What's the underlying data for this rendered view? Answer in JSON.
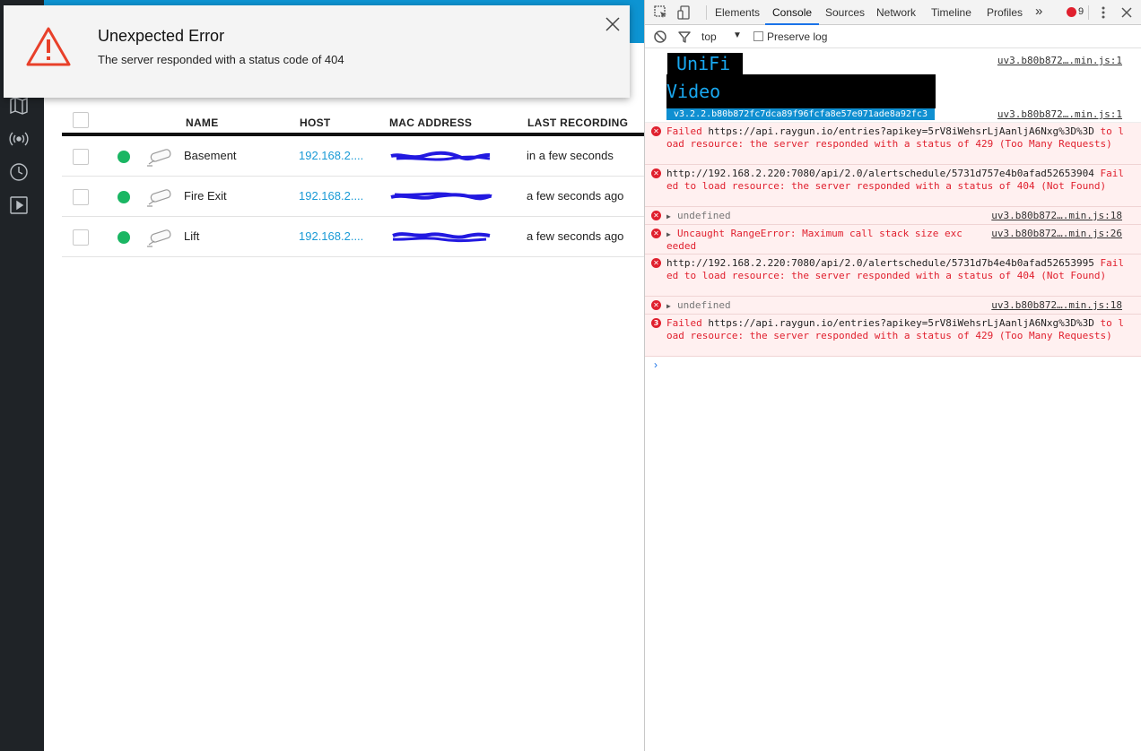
{
  "app": {
    "error": {
      "title": "Unexpected Error",
      "message": "The server responded with a status code of 404"
    },
    "table": {
      "headers": {
        "name": "NAME",
        "host": "HOST",
        "mac": "MAC ADDRESS",
        "recording": "LAST RECORDING"
      },
      "rows": [
        {
          "name": "Basement",
          "host": "192.168.2....",
          "recording": "in a few seconds",
          "status": "online"
        },
        {
          "name": "Fire Exit",
          "host": "192.168.2....",
          "recording": "a few seconds ago",
          "status": "online"
        },
        {
          "name": "Lift",
          "host": "192.168.2....",
          "recording": "a few seconds ago",
          "status": "online"
        }
      ]
    },
    "sidebar_icons": [
      "map-icon",
      "broadcast-icon",
      "clock-icon",
      "play-icon"
    ],
    "colors": {
      "accent": "#0d94d2",
      "online": "#1ab663",
      "sidebar": "#1f2327",
      "error_icon": "#e8402a"
    }
  },
  "devtools": {
    "tabs": [
      "Elements",
      "Console",
      "Sources",
      "Network",
      "Timeline",
      "Profiles"
    ],
    "active_tab": "Console",
    "more": "»",
    "error_count": "9",
    "context": "top",
    "preserve_log": "Preserve log",
    "banner": {
      "line1": "UniFi",
      "line2": "Video",
      "version": "v3.2.2.b80b872fc7dca89f96fcfa8e57e071ade8a92fc3",
      "source": "uv3.b80b872….min.js:1",
      "version_source": "uv3.b80b872….min.js:1"
    },
    "messages": [
      {
        "prefix": "Failed ",
        "url": "https://api.raygun.io/entries?apikey=5rV8iWehsrLjAanljA6Nxg%3D%3D",
        "text": " to load resource: the server responded with a status of 429 (Too Many Requests)"
      },
      {
        "prefix": "",
        "url": "http://192.168.2.220:7080/api/2.0/alertschedule/5731d757e4b0afad52653904",
        "text": " Failed to load resource: the server responded with a status of 404 (Not Found)"
      },
      {
        "undefined": "undefined",
        "source": "uv3.b80b872….min.js:18"
      },
      {
        "text": "Uncaught RangeError: Maximum call stack size exceeded",
        "source": "uv3.b80b872….min.js:26"
      },
      {
        "prefix": "",
        "url": "http://192.168.2.220:7080/api/2.0/alertschedule/5731d7b4e4b0afad52653995",
        "text": " Failed to load resource: the server responded with a status of 404 (Not Found)"
      },
      {
        "undefined": "undefined",
        "source": "uv3.b80b872….min.js:18"
      },
      {
        "repeat": "3",
        "prefix": "Failed ",
        "url": "https://api.raygun.io/entries?apikey=5rV8iWehsrLjAanljA6Nxg%3D%3D",
        "text": " to load resource: the server responded with a status of 429 (Too Many Requests)"
      }
    ],
    "prompt": "›"
  }
}
